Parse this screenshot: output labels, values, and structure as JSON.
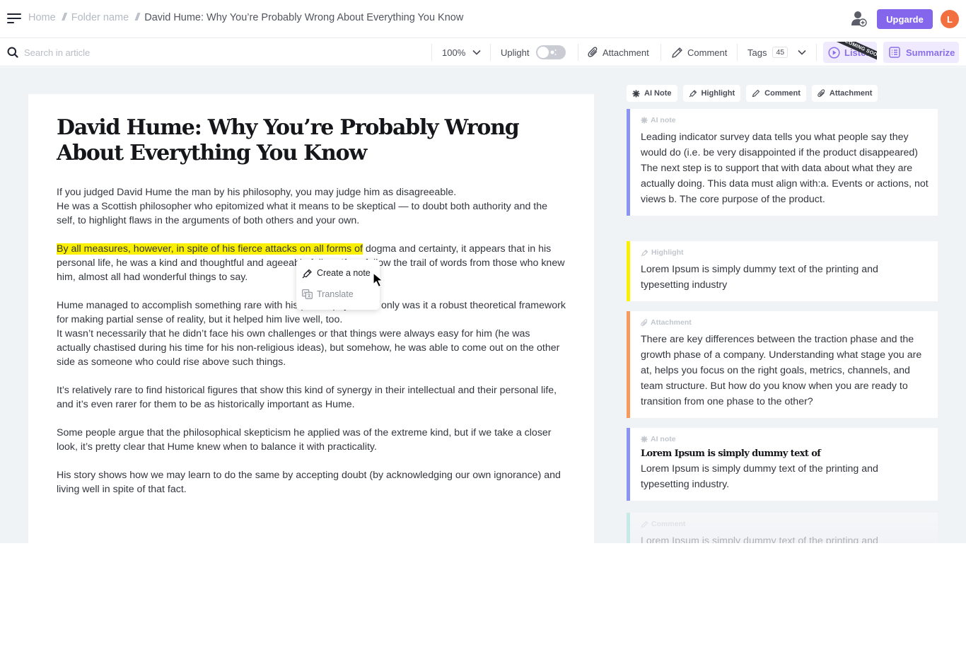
{
  "header": {
    "breadcrumb": [
      {
        "label": "Home"
      },
      {
        "label": "Folder name"
      },
      {
        "label": "David Hume: Why You’re Probably Wrong About Everything You Know"
      }
    ],
    "separator": "//",
    "upgrade_label": "Upgarde",
    "avatar_initial": "L",
    "colors": {
      "accent": "#8466ec",
      "avatar": "#f2703f"
    }
  },
  "toolbar": {
    "search_placeholder": "Search in article",
    "zoom_value": "100%",
    "uplight_label": "Uplight",
    "uplight_enabled": false,
    "attachment_label": "Attachment",
    "comment_label": "Comment",
    "tags_label": "Tags",
    "tags_count": "45",
    "listen_label": "Listen",
    "listen_badge": "COMING SOON",
    "summarize_label": "Summarize"
  },
  "article": {
    "title": "David Hume: Why You’re Probably Wrong About Everything You Know",
    "paragraphs": [
      {
        "lines": [
          "If you judged David Hume the man by his philosophy, you may judge him as disagreeable.",
          "He was a Scottish philosopher who epitomized what it means to be skeptical — to doubt both authority and the self, to highlight flaws in the arguments of both others and your own."
        ]
      },
      {
        "highlight": "By all measures, however, in spite of his fierce attacks on all forms of",
        "rest": " dogma and certainty, it appears that in his personal life, he was a kind and thoughtful and ageeable fellow. If we follow the trail of words from those who knew him, almost all had wonderful things to say."
      },
      {
        "lines": [
          "Hume managed to accomplish something rare with his philosophy — not only was it a robust theoretical framework for making partial sense of reality, but it helped him live well, too.",
          "It wasn’t necessarily that he didn’t face his own challenges or that things were always easy for him (he was actually chastised during his time for his non-religious ideas), but somehow, he was able to come out on the other side as someone who could rise above such things."
        ]
      },
      {
        "text": "It’s relatively rare to find historical figures that show this kind of synergy in their intellectual and their personal life, and it’s even rarer for them to be as historically important as Hume."
      },
      {
        "text": "Some people argue that the philosophical skepticism he applied was of the extreme kind, but if we take a closer look, it’s pretty clear that Hume knew when to balance it with practicality."
      },
      {
        "text": "His story shows how we may learn to do the same by accepting doubt (by acknowledging our own ignorance) and living well in spite of that fact."
      }
    ],
    "highlight_color": "#fbf000"
  },
  "context_menu": {
    "items": [
      {
        "label": "Create a note",
        "icon": "highlighter-icon"
      },
      {
        "label": "Translate",
        "icon": "translate-icon"
      }
    ]
  },
  "sidebar": {
    "filters": [
      {
        "label": "AI Note",
        "icon": "sparkle-icon"
      },
      {
        "label": "Highlight",
        "icon": "highlighter-icon"
      },
      {
        "label": "Comment",
        "icon": "pencil-icon"
      },
      {
        "label": "Attachment",
        "icon": "paperclip-icon"
      }
    ],
    "notes": [
      {
        "type": "AI note",
        "color": "#8b93f7",
        "text": "Leading indicator survey data tells you what people say they would do (i.e. be very disappointed if the product disappeared) The next step is to support that with data about what they are actually doing. This data must align with:a. Events or actions, not views b. The core purpose of the product."
      },
      {
        "type": "Highlight",
        "color": "#fbf000",
        "text": "Lorem Ipsum is simply dummy text of the printing and typesetting industry"
      },
      {
        "type": "Attachment",
        "color": "#f99a5c",
        "text": "There are key differences between the traction phase and the growth phase of a company. Understanding what stage you are at, helps you focus on the right goals, metrics, channels, and team structure. But how do you know when you are ready to transition from one phase to the other?"
      },
      {
        "type": "AI note",
        "color": "#8b93f7",
        "heading": "Lorem Ipsum is simply dummy text of",
        "text": "Lorem Ipsum is simply dummy text of the printing and typesetting industry."
      },
      {
        "type": "Comment",
        "color": "#7dd8d0",
        "text": "Lorem Ipsum is simply dummy text of the printing and typesetting industry"
      }
    ]
  }
}
